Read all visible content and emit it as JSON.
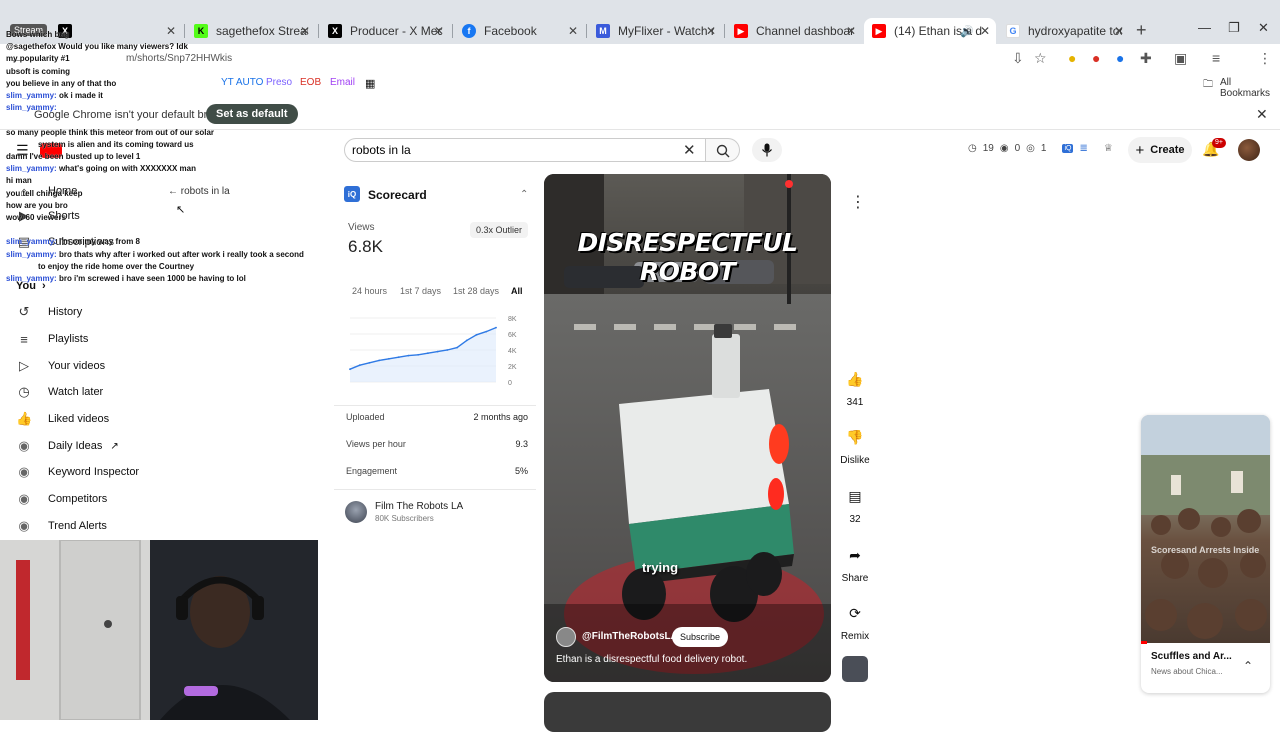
{
  "browser": {
    "tabs": [
      {
        "title": "",
        "favicon": "x-icon",
        "color": "#000000"
      },
      {
        "title": "sagethefox Stream -",
        "favicon": "kick-icon",
        "color": "#53fc18"
      },
      {
        "title": "Producer - X Media Stud",
        "favicon": "x-icon",
        "color": "#000000"
      },
      {
        "title": "Facebook",
        "favicon": "facebook-icon",
        "color": "#1877f2"
      },
      {
        "title": "MyFlixer - Watch movies",
        "favicon": "myflixer-icon",
        "color": "#3b5bdb"
      },
      {
        "title": "Channel dashboard - You",
        "favicon": "youtube-icon",
        "color": "#ff0000"
      },
      {
        "title": "(14) Ethan is a disres",
        "favicon": "youtube-icon",
        "color": "#ff0000"
      },
      {
        "title": "hydroxyapatite toothpas",
        "favicon": "google-icon",
        "color": "#4285f4"
      }
    ],
    "stream_label": "Stream",
    "url": "m/shorts/Snp72HHWkis",
    "bookmarks": [
      {
        "label": "YT AUTO",
        "color": "#1a73e8"
      },
      {
        "label": "Preso",
        "color": "#7b61ff"
      },
      {
        "label": "EOB",
        "color": "#d93025"
      },
      {
        "label": "Email",
        "color": "#a142f4"
      }
    ],
    "all_bookmarks": "All Bookmarks",
    "infobar_text": "Google Chrome isn't your default browser",
    "set_default": "Set as default"
  },
  "chat": [
    {
      "name": "",
      "text": "Bows which bug"
    },
    {
      "name": "",
      "text": "@sagethefox Would you like many viewers? Idk"
    },
    {
      "name": "",
      "text": "my popularity #1"
    },
    {
      "name": "",
      "text": "ubsoft is coming"
    },
    {
      "name": "",
      "text": "you believe in any of that tho"
    },
    {
      "name": "slim_yammy:",
      "text": "ok i made it"
    },
    {
      "name": "slim_yammy:",
      "text": ""
    },
    {
      "name": "",
      "text": ""
    },
    {
      "name": "",
      "text": "so many people think this meteor from out of our solar"
    },
    {
      "name": "",
      "text": "system is alien and its coming toward us"
    },
    {
      "name": "",
      "text": "damn I've been busted up to level 1"
    },
    {
      "name": "slim_yammy:",
      "text": "what's going on with XXXXXXX man"
    },
    {
      "name": "",
      "text": "hi man"
    },
    {
      "name": "",
      "text": "you tell chinga keep"
    },
    {
      "name": "",
      "text": "how are you bro"
    },
    {
      "name": "",
      "text": "wow 60 viewers"
    },
    {
      "name": "",
      "text": ""
    },
    {
      "name": "slim_yammy:",
      "text": "I'm on my way from 8"
    },
    {
      "name": "slim_yammy:",
      "text": "bro thats why after i worked out after work i really took a second"
    },
    {
      "name": "",
      "text": "to enjoy the ride home over the Courtney"
    },
    {
      "name": "slim_yammy:",
      "text": "bro i'm screwed i have seen 1000 be having to lol"
    }
  ],
  "youtube": {
    "search_value": "robots in la",
    "top_stats": {
      "views": "19",
      "eye": "0",
      "other": "1"
    },
    "create_label": "Create",
    "notif_count": "9+",
    "sidebar": [
      {
        "label": "You",
        "icon": "chevron-right-icon"
      },
      {
        "label": "History",
        "icon": "history-icon"
      },
      {
        "label": "Playlists",
        "icon": "playlist-icon"
      },
      {
        "label": "Your videos",
        "icon": "play-box-icon"
      },
      {
        "label": "Watch later",
        "icon": "clock-icon"
      },
      {
        "label": "Liked videos",
        "icon": "thumb-up-icon"
      },
      {
        "label": "Daily Ideas",
        "icon": "vidiq-icon"
      },
      {
        "label": "Keyword Inspector",
        "icon": "vidiq-icon"
      },
      {
        "label": "Competitors",
        "icon": "vidiq-icon"
      },
      {
        "label": "Trend Alerts",
        "icon": "vidiq-icon"
      }
    ],
    "overlay_nav": [
      {
        "label": "Home"
      },
      {
        "label": "Shorts"
      },
      {
        "label": "Subscriptions"
      }
    ],
    "breadcrumb_search": "robots in la"
  },
  "scorecard": {
    "title": "Scorecard",
    "views_label": "Views",
    "views_value": "6.8K",
    "outlier": "0.3x Outlier",
    "ranges": [
      "24 hours",
      "1st 7 days",
      "1st 28 days",
      "All"
    ],
    "selected_range": "All",
    "rows": [
      {
        "label": "Uploaded",
        "value": "2 months ago"
      },
      {
        "label": "Views per hour",
        "value": "9.3"
      },
      {
        "label": "Engagement",
        "value": "5%"
      }
    ],
    "channel_name": "Film The Robots LA",
    "channel_subs": "80K Subscribers"
  },
  "chart_data": {
    "type": "line",
    "title": "",
    "xlabel": "",
    "ylabel": "",
    "yticks": [
      "8K",
      "6K",
      "4K",
      "2K",
      "0"
    ],
    "ylim": [
      0,
      8000
    ],
    "grid": true,
    "series": [
      {
        "values": [
          1600,
          2100,
          2400,
          2700,
          2900,
          3100,
          3300,
          3400,
          3600,
          3800,
          4000,
          4300,
          5200,
          5900,
          6300,
          6800
        ]
      }
    ]
  },
  "video": {
    "title_overlay": "DISRESPECTFUL ROBOT",
    "caption": "trying",
    "channel": "@FilmTheRobotsLA",
    "subscribe": "Subscribe",
    "description": "Ethan is a disrespectful food delivery robot."
  },
  "actions": [
    {
      "label": "341",
      "icon": "thumb-up-icon"
    },
    {
      "label": "Dislike",
      "icon": "thumb-down-icon"
    },
    {
      "label": "32",
      "icon": "comment-icon"
    },
    {
      "label": "Share",
      "icon": "share-icon"
    },
    {
      "label": "Remix",
      "icon": "remix-icon"
    }
  ],
  "side_card": {
    "title": "Scuffles and Ar...",
    "subtitle": "News about Chica...",
    "watermark": "Scoresand Arrests Inside"
  }
}
